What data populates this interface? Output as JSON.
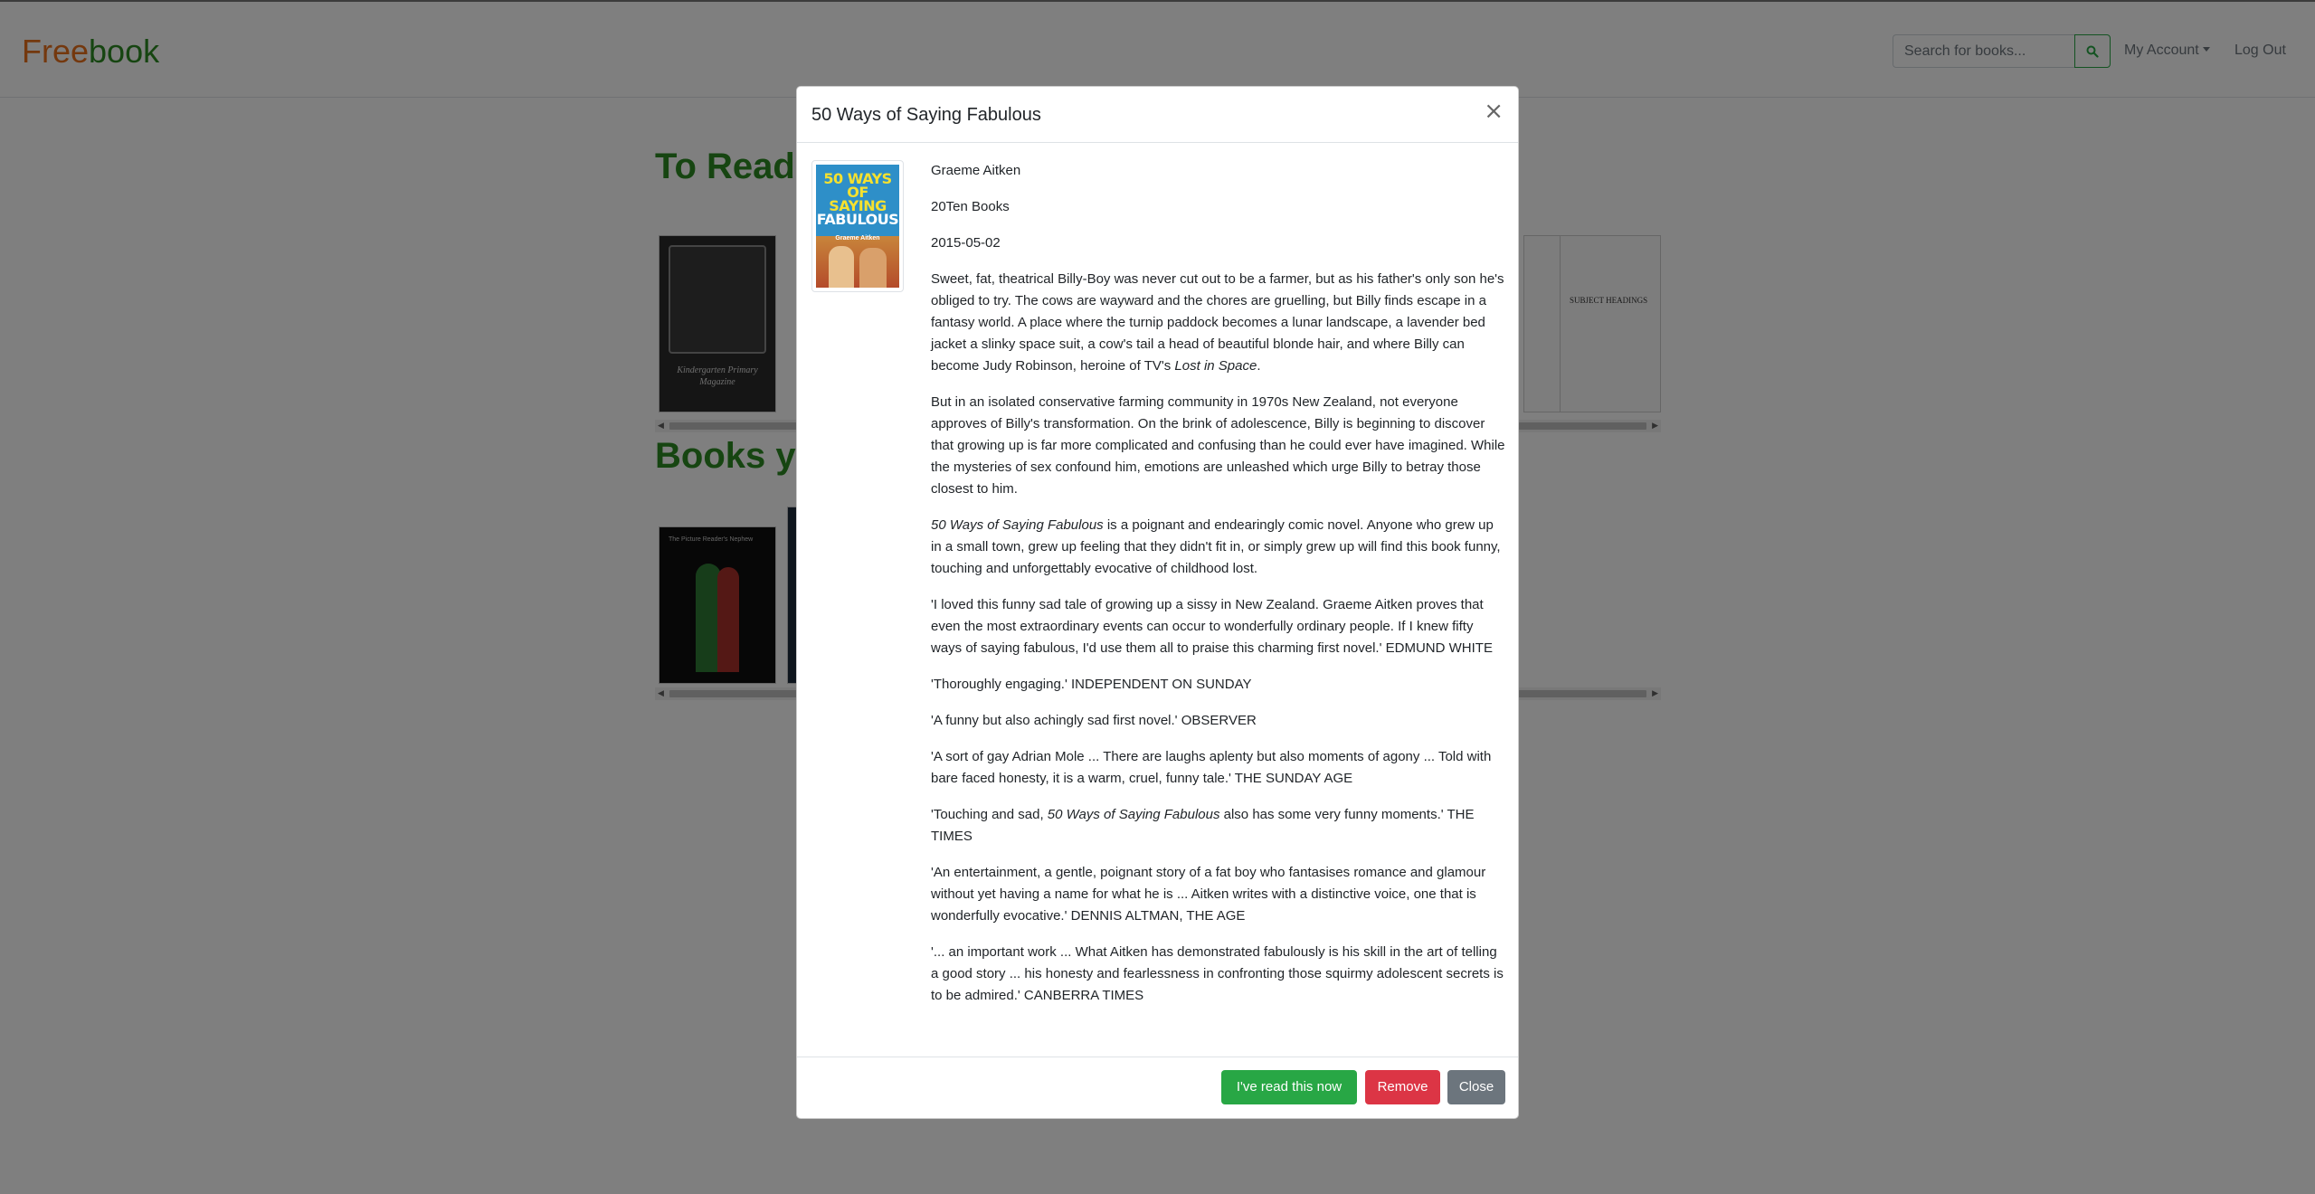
{
  "brand": {
    "part1": "Free",
    "part2": "book"
  },
  "nav": {
    "search_placeholder": "Search for books...",
    "search_icon": "search-icon",
    "my_account": "My Account",
    "log_out": "Log Out"
  },
  "sections": {
    "to_read": "To Read",
    "books_you": "Books yo"
  },
  "background_books": {
    "kindergarten_title": "Kindergarten Primary Magazine",
    "subject_headings": "SUBJECT HEADINGS",
    "pickers_title": "The Picture Reader's Nephew"
  },
  "modal": {
    "title": "50 Ways of Saying Fabulous",
    "close_symbol": "×",
    "cover": {
      "title_line1": "50 WAYS",
      "title_line2": "OF SAYING",
      "title_line3": "FABULOUS",
      "author": "Graeme Aitken"
    },
    "author": "Graeme Aitken",
    "publisher": "20Ten Books",
    "date": "2015-05-02",
    "desc1_a": "Sweet, fat, theatrical Billy-Boy was never cut out to be a farmer, but as his father's only son he's obliged to try. The cows are wayward and the chores are gruelling, but Billy finds escape in a fantasy world. A place where the turnip paddock becomes a lunar landscape, a lavender bed jacket a slinky space suit, a cow's tail a head of beautiful blonde hair, and where Billy can become Judy Robinson, heroine of TV's ",
    "desc1_italic": "Lost in Space",
    "desc1_end": ".",
    "desc2": "But in an isolated conservative farming community in 1970s New Zealand, not everyone approves of Billy's transformation. On the brink of adolescence, Billy is beginning to discover that growing up is far more complicated and confusing than he could ever have imagined. While the mysteries of sex confound him, emotions are unleashed which urge Billy to betray those closest to him.",
    "desc3_italic": "50 Ways of Saying Fabulous",
    "desc3_rest": " is a poignant and endearingly comic novel. Anyone who grew up in a small town, grew up feeling that they didn't fit in, or simply grew up will find this book funny, touching and unforgettably evocative of childhood lost.",
    "quote1": "'I loved this funny sad tale of growing up a sissy in New Zealand. Graeme Aitken proves that even the most extraordinary events can occur to wonderfully ordinary people. If I knew fifty ways of saying fabulous, I'd use them all to praise this charming first novel.' EDMUND WHITE",
    "quote2": "'Thoroughly engaging.' INDEPENDENT ON SUNDAY",
    "quote3": "'A funny but also achingly sad first novel.' OBSERVER",
    "quote4": "'A sort of gay Adrian Mole ... There are laughs aplenty but also moments of agony ... Told with bare faced honesty, it is a warm, cruel, funny tale.' THE SUNDAY AGE",
    "quote5_a": "'Touching and sad, ",
    "quote5_italic": "50 Ways of Saying Fabulous",
    "quote5_rest": " also has some very funny moments.' THE TIMES",
    "quote6": "'An entertainment, a gentle, poignant story of a fat boy who fantasises romance and glamour without yet having a name for what he is ... Aitken writes with a distinctive voice, one that is wonderfully evocative.' DENNIS ALTMAN, THE AGE",
    "quote7": "'... an important work ... What Aitken has demonstrated fabulously is his skill in the art of telling a good story ... his honesty and fearlessness in confronting those squirmy adolescent secrets is to be admired.' CANBERRA TIMES",
    "buttons": {
      "read": "I've read this now",
      "remove": "Remove",
      "close": "Close"
    }
  },
  "colors": {
    "brand_orange": "#e8711c",
    "brand_green": "#2c8a23",
    "success": "#28a745",
    "danger": "#dc3545",
    "secondary": "#6c757d"
  }
}
